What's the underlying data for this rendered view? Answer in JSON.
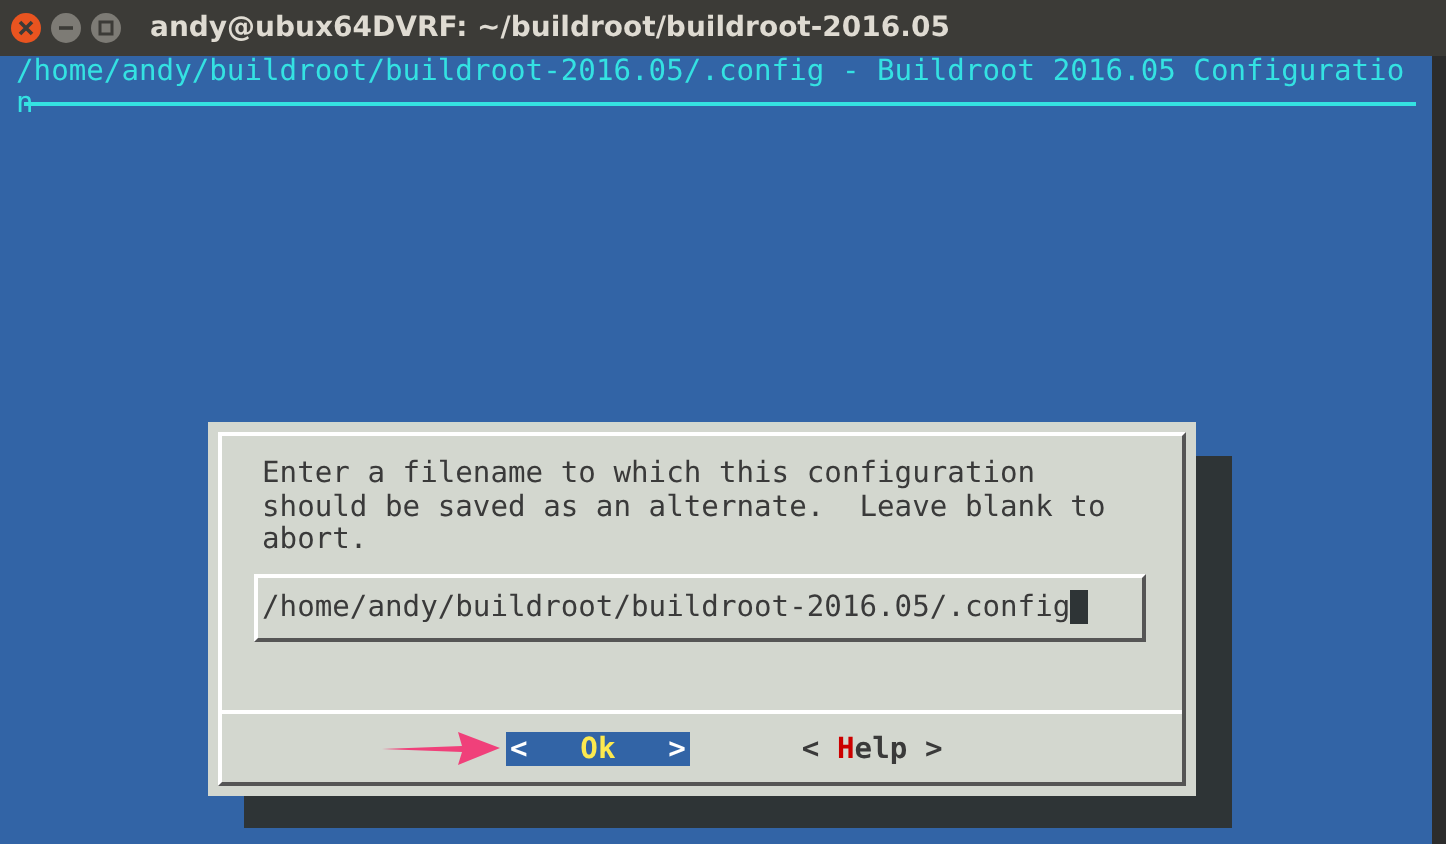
{
  "window": {
    "title": "andy@ubux64DVRF: ~/buildroot/buildroot-2016.05"
  },
  "terminal": {
    "header_lines": [
      "/home/andy/buildroot/buildroot-2016.05/.config - Buildroot 2016.05 Configuratio",
      "n"
    ]
  },
  "dialog": {
    "message": "Enter a filename to which this configuration\nshould be saved as an alternate.  Leave blank to\nabort.",
    "input_value": "/home/andy/buildroot/buildroot-2016.05/.config",
    "buttons": [
      {
        "open": "<",
        "hotkey": "O",
        "rest": "k",
        "close": ">",
        "selected": true
      },
      {
        "open": "<",
        "hotkey": "H",
        "rest": "elp",
        "close": ">",
        "selected": false
      }
    ]
  }
}
